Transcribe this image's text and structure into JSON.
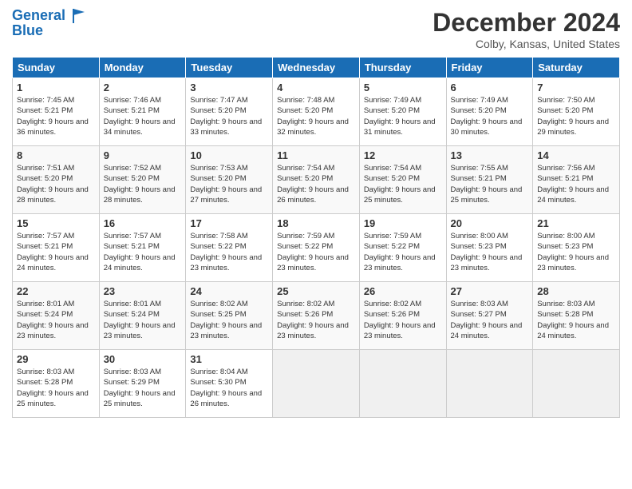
{
  "header": {
    "logo_line1": "General",
    "logo_line2": "Blue",
    "month_title": "December 2024",
    "location": "Colby, Kansas, United States"
  },
  "days_of_week": [
    "Sunday",
    "Monday",
    "Tuesday",
    "Wednesday",
    "Thursday",
    "Friday",
    "Saturday"
  ],
  "weeks": [
    [
      {
        "day": "1",
        "sunrise": "Sunrise: 7:45 AM",
        "sunset": "Sunset: 5:21 PM",
        "daylight": "Daylight: 9 hours and 36 minutes."
      },
      {
        "day": "2",
        "sunrise": "Sunrise: 7:46 AM",
        "sunset": "Sunset: 5:21 PM",
        "daylight": "Daylight: 9 hours and 34 minutes."
      },
      {
        "day": "3",
        "sunrise": "Sunrise: 7:47 AM",
        "sunset": "Sunset: 5:20 PM",
        "daylight": "Daylight: 9 hours and 33 minutes."
      },
      {
        "day": "4",
        "sunrise": "Sunrise: 7:48 AM",
        "sunset": "Sunset: 5:20 PM",
        "daylight": "Daylight: 9 hours and 32 minutes."
      },
      {
        "day": "5",
        "sunrise": "Sunrise: 7:49 AM",
        "sunset": "Sunset: 5:20 PM",
        "daylight": "Daylight: 9 hours and 31 minutes."
      },
      {
        "day": "6",
        "sunrise": "Sunrise: 7:49 AM",
        "sunset": "Sunset: 5:20 PM",
        "daylight": "Daylight: 9 hours and 30 minutes."
      },
      {
        "day": "7",
        "sunrise": "Sunrise: 7:50 AM",
        "sunset": "Sunset: 5:20 PM",
        "daylight": "Daylight: 9 hours and 29 minutes."
      }
    ],
    [
      {
        "day": "8",
        "sunrise": "Sunrise: 7:51 AM",
        "sunset": "Sunset: 5:20 PM",
        "daylight": "Daylight: 9 hours and 28 minutes."
      },
      {
        "day": "9",
        "sunrise": "Sunrise: 7:52 AM",
        "sunset": "Sunset: 5:20 PM",
        "daylight": "Daylight: 9 hours and 28 minutes."
      },
      {
        "day": "10",
        "sunrise": "Sunrise: 7:53 AM",
        "sunset": "Sunset: 5:20 PM",
        "daylight": "Daylight: 9 hours and 27 minutes."
      },
      {
        "day": "11",
        "sunrise": "Sunrise: 7:54 AM",
        "sunset": "Sunset: 5:20 PM",
        "daylight": "Daylight: 9 hours and 26 minutes."
      },
      {
        "day": "12",
        "sunrise": "Sunrise: 7:54 AM",
        "sunset": "Sunset: 5:20 PM",
        "daylight": "Daylight: 9 hours and 25 minutes."
      },
      {
        "day": "13",
        "sunrise": "Sunrise: 7:55 AM",
        "sunset": "Sunset: 5:21 PM",
        "daylight": "Daylight: 9 hours and 25 minutes."
      },
      {
        "day": "14",
        "sunrise": "Sunrise: 7:56 AM",
        "sunset": "Sunset: 5:21 PM",
        "daylight": "Daylight: 9 hours and 24 minutes."
      }
    ],
    [
      {
        "day": "15",
        "sunrise": "Sunrise: 7:57 AM",
        "sunset": "Sunset: 5:21 PM",
        "daylight": "Daylight: 9 hours and 24 minutes."
      },
      {
        "day": "16",
        "sunrise": "Sunrise: 7:57 AM",
        "sunset": "Sunset: 5:21 PM",
        "daylight": "Daylight: 9 hours and 24 minutes."
      },
      {
        "day": "17",
        "sunrise": "Sunrise: 7:58 AM",
        "sunset": "Sunset: 5:22 PM",
        "daylight": "Daylight: 9 hours and 23 minutes."
      },
      {
        "day": "18",
        "sunrise": "Sunrise: 7:59 AM",
        "sunset": "Sunset: 5:22 PM",
        "daylight": "Daylight: 9 hours and 23 minutes."
      },
      {
        "day": "19",
        "sunrise": "Sunrise: 7:59 AM",
        "sunset": "Sunset: 5:22 PM",
        "daylight": "Daylight: 9 hours and 23 minutes."
      },
      {
        "day": "20",
        "sunrise": "Sunrise: 8:00 AM",
        "sunset": "Sunset: 5:23 PM",
        "daylight": "Daylight: 9 hours and 23 minutes."
      },
      {
        "day": "21",
        "sunrise": "Sunrise: 8:00 AM",
        "sunset": "Sunset: 5:23 PM",
        "daylight": "Daylight: 9 hours and 23 minutes."
      }
    ],
    [
      {
        "day": "22",
        "sunrise": "Sunrise: 8:01 AM",
        "sunset": "Sunset: 5:24 PM",
        "daylight": "Daylight: 9 hours and 23 minutes."
      },
      {
        "day": "23",
        "sunrise": "Sunrise: 8:01 AM",
        "sunset": "Sunset: 5:24 PM",
        "daylight": "Daylight: 9 hours and 23 minutes."
      },
      {
        "day": "24",
        "sunrise": "Sunrise: 8:02 AM",
        "sunset": "Sunset: 5:25 PM",
        "daylight": "Daylight: 9 hours and 23 minutes."
      },
      {
        "day": "25",
        "sunrise": "Sunrise: 8:02 AM",
        "sunset": "Sunset: 5:26 PM",
        "daylight": "Daylight: 9 hours and 23 minutes."
      },
      {
        "day": "26",
        "sunrise": "Sunrise: 8:02 AM",
        "sunset": "Sunset: 5:26 PM",
        "daylight": "Daylight: 9 hours and 23 minutes."
      },
      {
        "day": "27",
        "sunrise": "Sunrise: 8:03 AM",
        "sunset": "Sunset: 5:27 PM",
        "daylight": "Daylight: 9 hours and 24 minutes."
      },
      {
        "day": "28",
        "sunrise": "Sunrise: 8:03 AM",
        "sunset": "Sunset: 5:28 PM",
        "daylight": "Daylight: 9 hours and 24 minutes."
      }
    ],
    [
      {
        "day": "29",
        "sunrise": "Sunrise: 8:03 AM",
        "sunset": "Sunset: 5:28 PM",
        "daylight": "Daylight: 9 hours and 25 minutes."
      },
      {
        "day": "30",
        "sunrise": "Sunrise: 8:03 AM",
        "sunset": "Sunset: 5:29 PM",
        "daylight": "Daylight: 9 hours and 25 minutes."
      },
      {
        "day": "31",
        "sunrise": "Sunrise: 8:04 AM",
        "sunset": "Sunset: 5:30 PM",
        "daylight": "Daylight: 9 hours and 26 minutes."
      },
      null,
      null,
      null,
      null
    ]
  ]
}
